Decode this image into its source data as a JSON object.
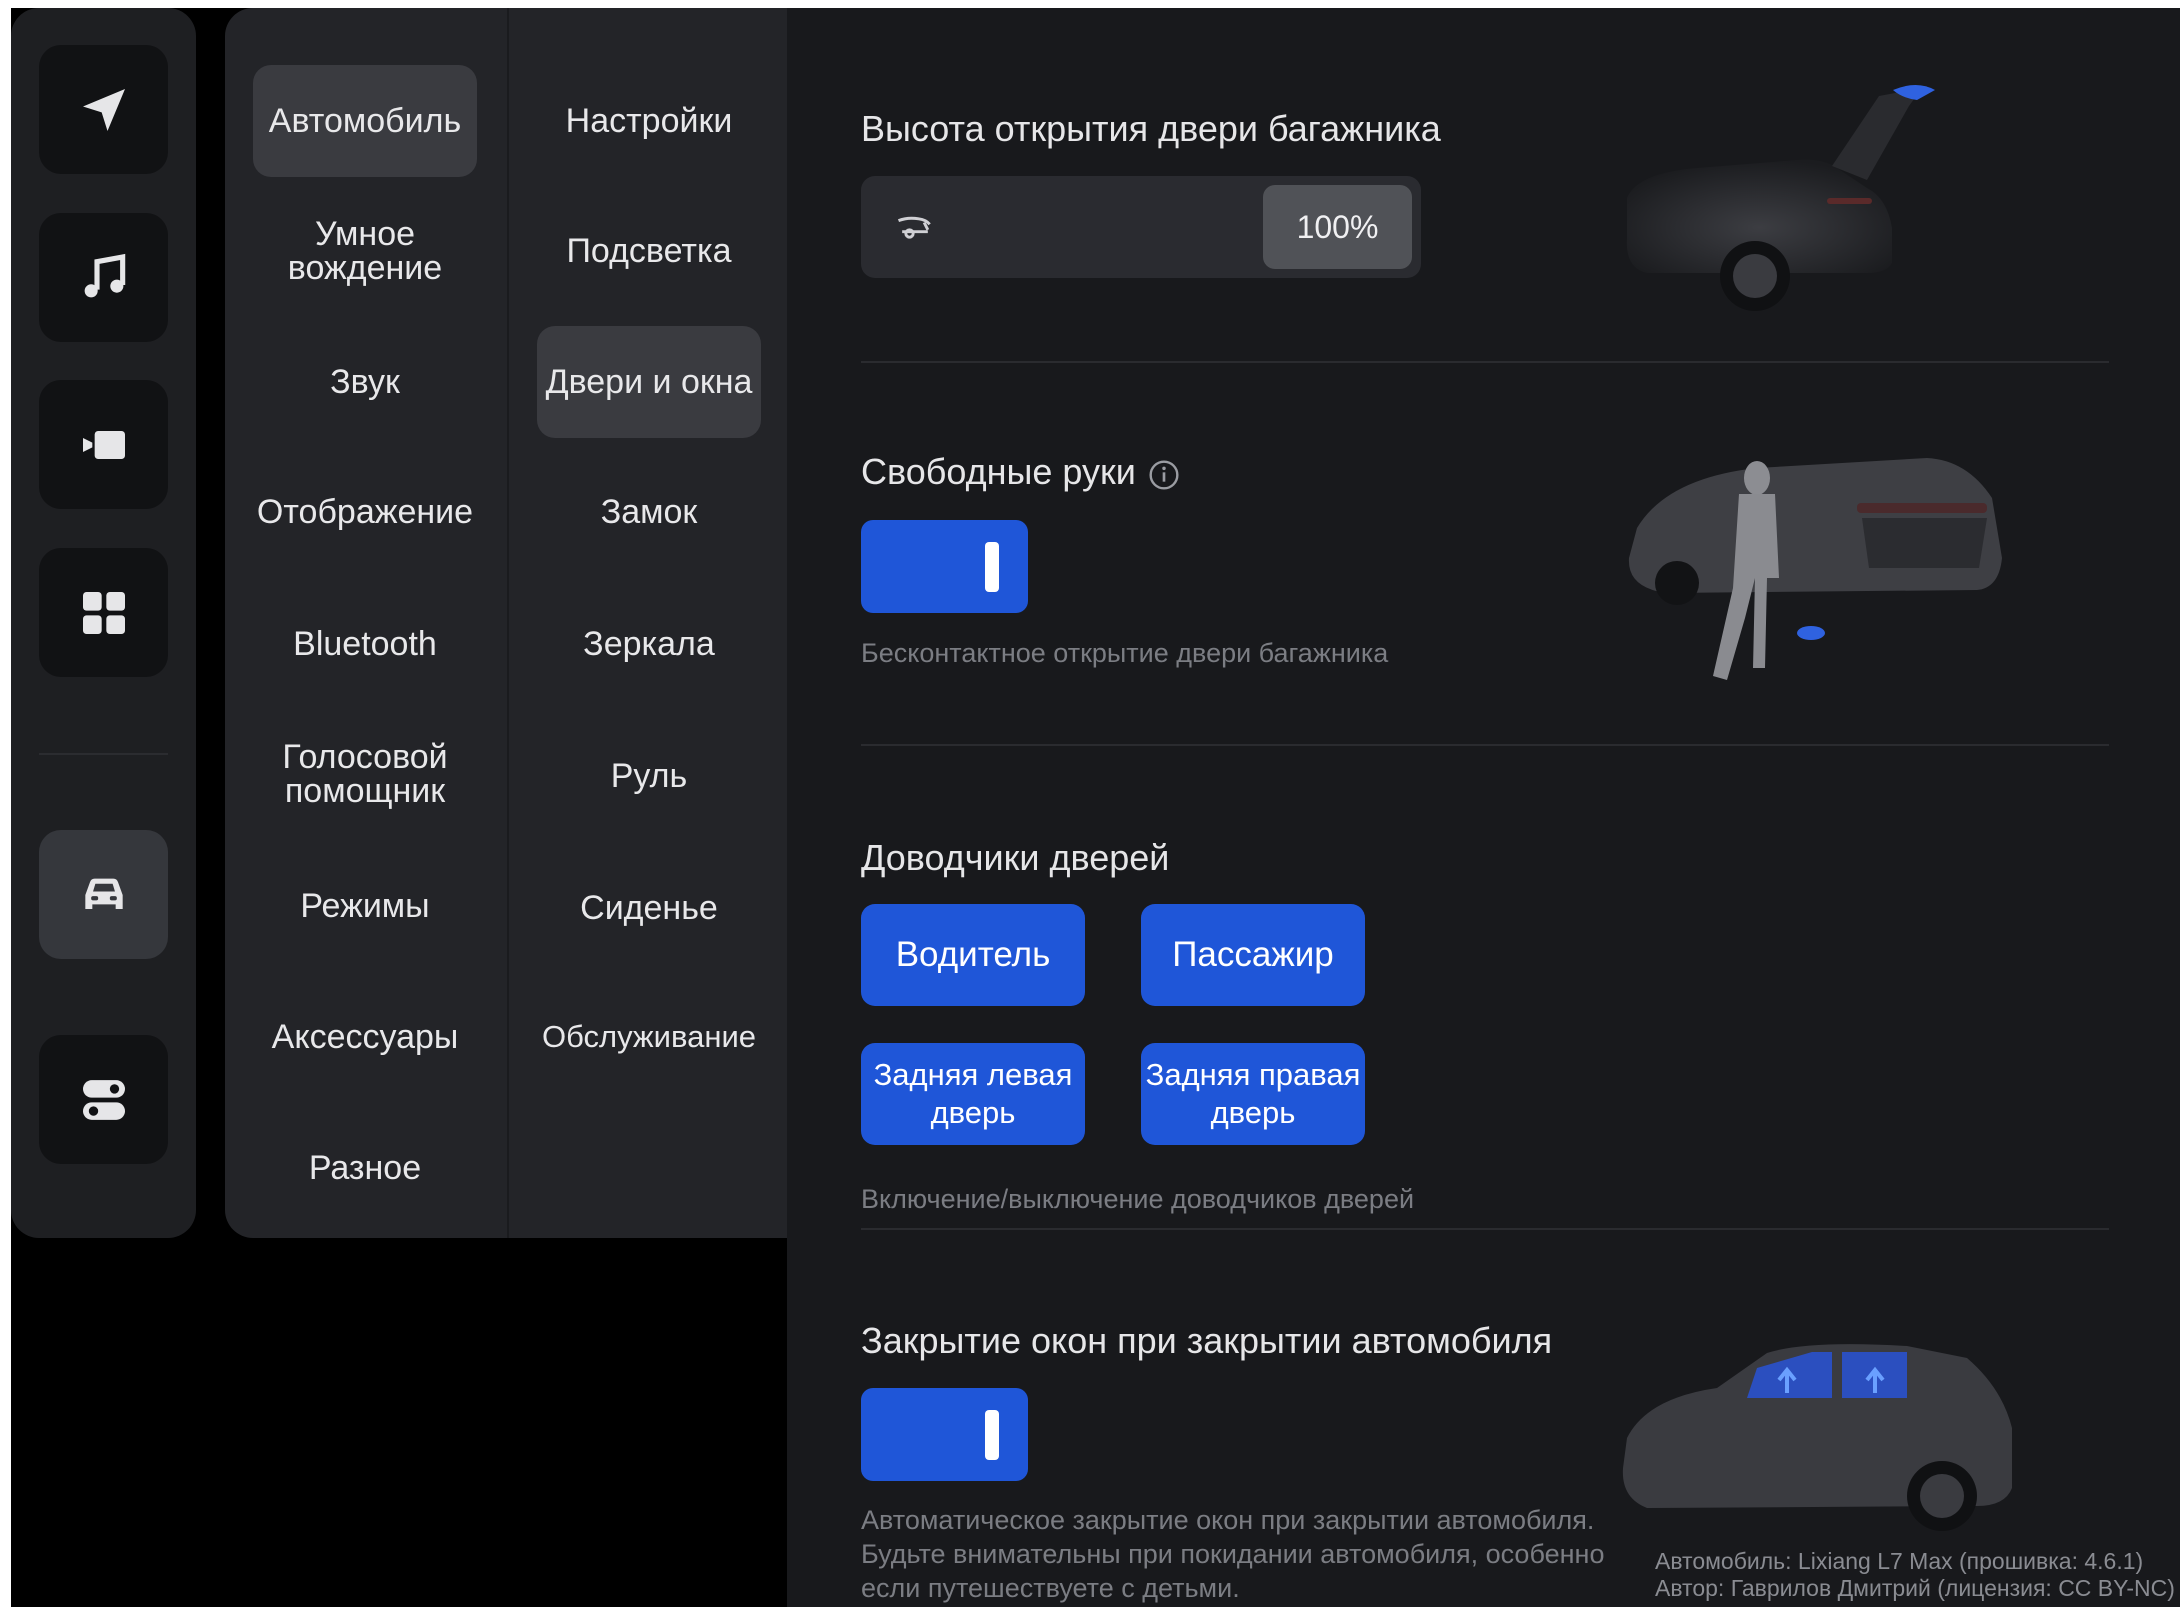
{
  "rail": {
    "items": [
      {
        "name": "navigation-icon",
        "active": false
      },
      {
        "name": "music-icon",
        "active": false
      },
      {
        "name": "video-icon",
        "active": false
      },
      {
        "name": "apps-grid-icon",
        "active": false
      },
      {
        "name": "car-icon",
        "active": true
      },
      {
        "name": "toggles-icon",
        "active": false
      }
    ]
  },
  "menu_primary": {
    "items": [
      "Автомобиль",
      "Умное вождение",
      "Звук",
      "Отображение",
      "Bluetooth",
      "Голосовой помощник",
      "Режимы",
      "Аксессуары",
      "Разное"
    ],
    "selected": "Автомобиль"
  },
  "menu_secondary": {
    "items": [
      "Настройки",
      "Подсветка",
      "Двери и окна",
      "Замок",
      "Зеркала",
      "Руль",
      "Сиденье",
      "Обслуживание"
    ],
    "selected": "Двери и окна"
  },
  "trunk_height": {
    "title": "Высота открытия двери багажника",
    "value": "100%",
    "level": 1.0
  },
  "hands_free": {
    "title": "Свободные руки",
    "enabled": true,
    "description": "Бесконтактное открытие двери багажника"
  },
  "door_closers": {
    "title": "Доводчики дверей",
    "buttons": [
      "Водитель",
      "Пассажир",
      "Задняя левая дверь",
      "Задняя правая дверь"
    ],
    "description": "Включение/выключение доводчиков дверей"
  },
  "window_close": {
    "title": "Закрытие окон при закрытии автомобиля",
    "enabled": true,
    "description_lines": [
      "Автоматическое закрытие окон при закрытии автомобиля.",
      "Будьте внимательны при покидании автомобиля, особенно",
      "если путешествуете с детьми."
    ]
  },
  "credits": {
    "line1": "Автомобиль: Lixiang L7 Max (прошивка: 4.6.1)",
    "line2": "Автор: Гаврилов Дмитрий (лицензия: CC BY-NC)"
  },
  "colors": {
    "accent": "#1f56d8",
    "panel": "#232428",
    "background": "#18191c"
  }
}
